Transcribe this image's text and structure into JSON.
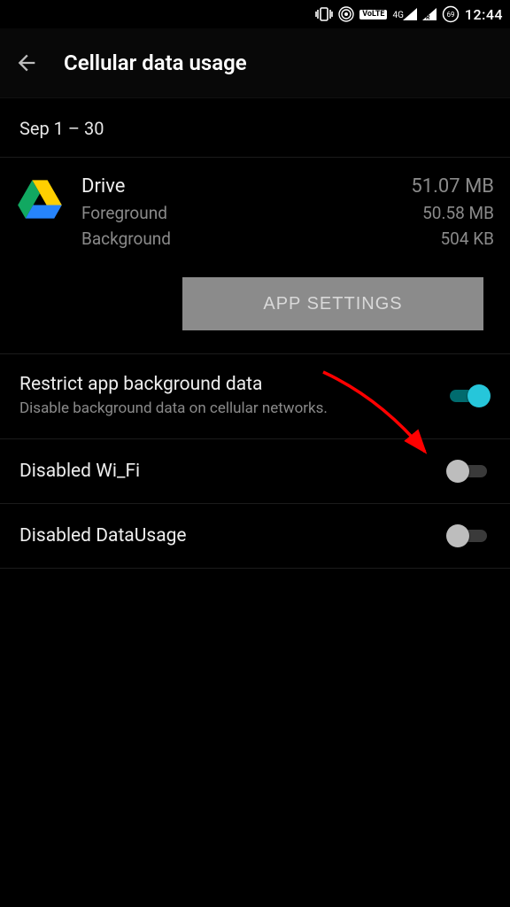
{
  "statusbar": {
    "volte": "VoLTE",
    "net": "4G",
    "battery": "69",
    "time": "12:44"
  },
  "header": {
    "title": "Cellular data usage"
  },
  "date_range": "Sep 1 – 30",
  "app": {
    "name": "Drive",
    "total": "51.07 MB",
    "fg_label": "Foreground",
    "fg_value": "50.58 MB",
    "bg_label": "Background",
    "bg_value": "504 KB"
  },
  "button_app_settings": "APP SETTINGS",
  "settings": {
    "restrict": {
      "title": "Restrict app background data",
      "sub": "Disable background data on cellular networks.",
      "on": true
    },
    "wifi": {
      "title": "Disabled Wi_Fi",
      "on": false
    },
    "datausage": {
      "title": "Disabled DataUsage",
      "on": false
    }
  }
}
